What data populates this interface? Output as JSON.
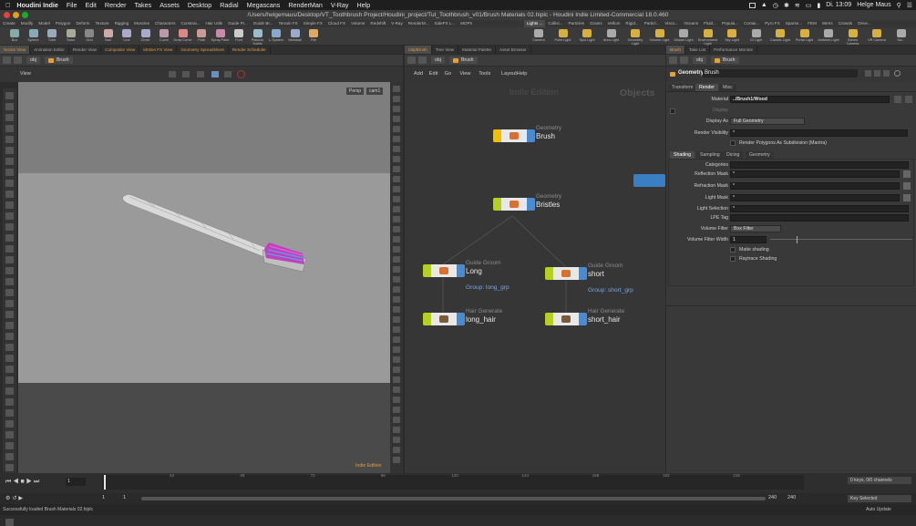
{
  "menubar": {
    "apple": "",
    "app": "Houdini Indie",
    "items": [
      "File",
      "Edit",
      "Render",
      "Takes",
      "Assets",
      "Desktop",
      "Radial",
      "Megascans",
      "RenderMan",
      "V-Ray",
      "Help"
    ],
    "clock": "Di. 13:09",
    "user": "Helge Maus"
  },
  "title": "/Users/helgemaus/Desktop/VT_Toothbrush Project/Houdini_project/Tut_Toothbrush_v01/Brush Materials 02.hiplc - Houdini Indie Limited-Commercial 18.0.460",
  "shelf_tabs_left": [
    "Create",
    "Modify",
    "Model",
    "Polygon",
    "Deform",
    "Texture",
    "Rigging",
    "Muscles",
    "Characters",
    "Constrai...",
    "Hair Utils",
    "Guide Pr...",
    "Guide Br...",
    "Terrain FX",
    "Simple FX",
    "Cloud FX",
    "Volume",
    "Redshift",
    "V-Ray",
    "RenderM...",
    "SideFX L...",
    "MOPs"
  ],
  "shelf_tabs_right": [
    "Lights ...",
    "Collisi...",
    "Particles",
    "Grains",
    "Vellum",
    "Rigid...",
    "Particl...",
    "Visco...",
    "Oceans",
    "Fluid...",
    "Popula...",
    "Contai...",
    "Pyro FX",
    "Sparse...",
    "FEM",
    "Wires",
    "Crowds",
    "Drive..."
  ],
  "tools_left": [
    "Box",
    "Sphere",
    "Tube",
    "Torus",
    "Grid",
    "Null",
    "Line",
    "Circle",
    "Curve",
    "Draw Curve",
    "Path",
    "Spray Paint",
    "Font",
    "Platonic Solids",
    "L-System",
    "Metaball",
    "File"
  ],
  "tools_right": [
    "Camera",
    "Point Light",
    "Spot Light",
    "Area Light",
    "Geometry Light",
    "Volume Light",
    "Distant Light",
    "Environment Light",
    "Sky Light",
    "GI Light",
    "Caustic Light",
    "Portal Light",
    "Ambient Light",
    "Stereo Camera",
    "VR Camera",
    "Sw..."
  ],
  "left_tabs": [
    "Scene View",
    "Animation Editor",
    "Render View",
    "Composite View",
    "Motion FX View",
    "Geometry Spreadsheet",
    "Render Scheduler"
  ],
  "ne_tabs": [
    "/obj/Brush",
    "Tree View",
    "Material Palette",
    "Asset Browser"
  ],
  "param_tabs": [
    "Brush",
    "Take List",
    "Performance Monitor"
  ],
  "path_obj": "obj",
  "path_brush": "Brush",
  "viewport": {
    "label": "View",
    "persp": "Persp",
    "cam": "cam1",
    "edition": "Indie Edition"
  },
  "network_menu": [
    "Add",
    "Edit",
    "Go",
    "View",
    "Tools",
    "Layout",
    "Help"
  ],
  "network": {
    "watermark": "Indie Edition",
    "context": "Objects",
    "nodes": [
      {
        "type": "Geometry",
        "name": "Brush",
        "group": ""
      },
      {
        "type": "Geometry",
        "name": "Bristles",
        "group": ""
      },
      {
        "type": "Guide Groom",
        "name": "Long",
        "group": "Group: long_grp"
      },
      {
        "type": "Guide Groom",
        "name": "short",
        "group": "Group: short_grp"
      },
      {
        "type": "Hair Generate",
        "name": "long_hair",
        "group": ""
      },
      {
        "type": "Hair Generate",
        "name": "short_hair",
        "group": ""
      }
    ]
  },
  "params": {
    "header_type": "Geometry",
    "header_name": "Brush",
    "tabs": [
      "Transform",
      "Render",
      "Misc"
    ],
    "material_label": "Material",
    "material": "../Brush1/Wood",
    "display_label": "Display",
    "display_as_label": "Display As",
    "display_as": "Full Geometry",
    "render_vis_label": "Render Visibility",
    "render_vis": "*",
    "subdiv": "Render Polygons As Subdivision (Mantra)",
    "subtabs": [
      "Shading",
      "Sampling",
      "Dicing",
      "Geometry"
    ],
    "categories_label": "Categories",
    "reflection_label": "Reflection Mask",
    "reflection": "*",
    "refraction_label": "Refraction Mask",
    "refraction": "*",
    "light_mask_label": "Light Mask",
    "light_mask": "*",
    "light_sel_label": "Light Selection",
    "light_sel": "*",
    "lpe_label": "LPE Tag",
    "vol_filter_label": "Volume Filter",
    "vol_filter": "Box Filter",
    "vol_width_label": "Volume Filter Width",
    "vol_width": "1",
    "matte": "Matte shading",
    "raytrace": "Raytrace Shading"
  },
  "timeline": {
    "frame": "1",
    "ticks": [
      "24",
      "48",
      "72",
      "96",
      "120",
      "144",
      "168",
      "192",
      "216"
    ],
    "start": "1",
    "start2": "1",
    "end": "240",
    "end2": "240",
    "keys": "0 keys, 0/0 channels",
    "key_selected": "Key Selected",
    "auto_update": "Auto Update"
  },
  "status": "Successfully loaded Brush Materials 02.hiplc"
}
